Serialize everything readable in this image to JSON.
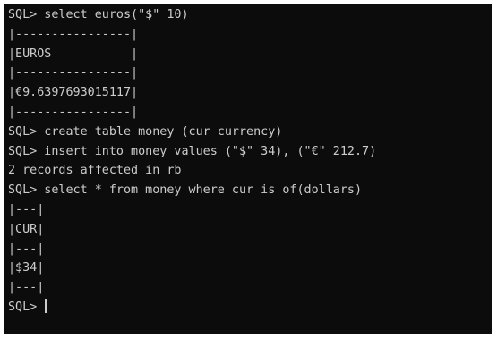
{
  "terminal": {
    "lines": [
      "SQL> select euros(\"$\" 10)",
      "|----------------|",
      "|EUROS           |",
      "|----------------|",
      "|€9.6397693015117|",
      "|----------------|",
      "SQL> create table money (cur currency)",
      "SQL> insert into money values (\"$\" 34), (\"€\" 212.7)",
      "2 records affected in rb",
      "SQL> select * from money where cur is of(dollars)",
      "|---|",
      "|CUR|",
      "|---|",
      "|$34|",
      "|---|"
    ],
    "prompt": "SQL> "
  }
}
